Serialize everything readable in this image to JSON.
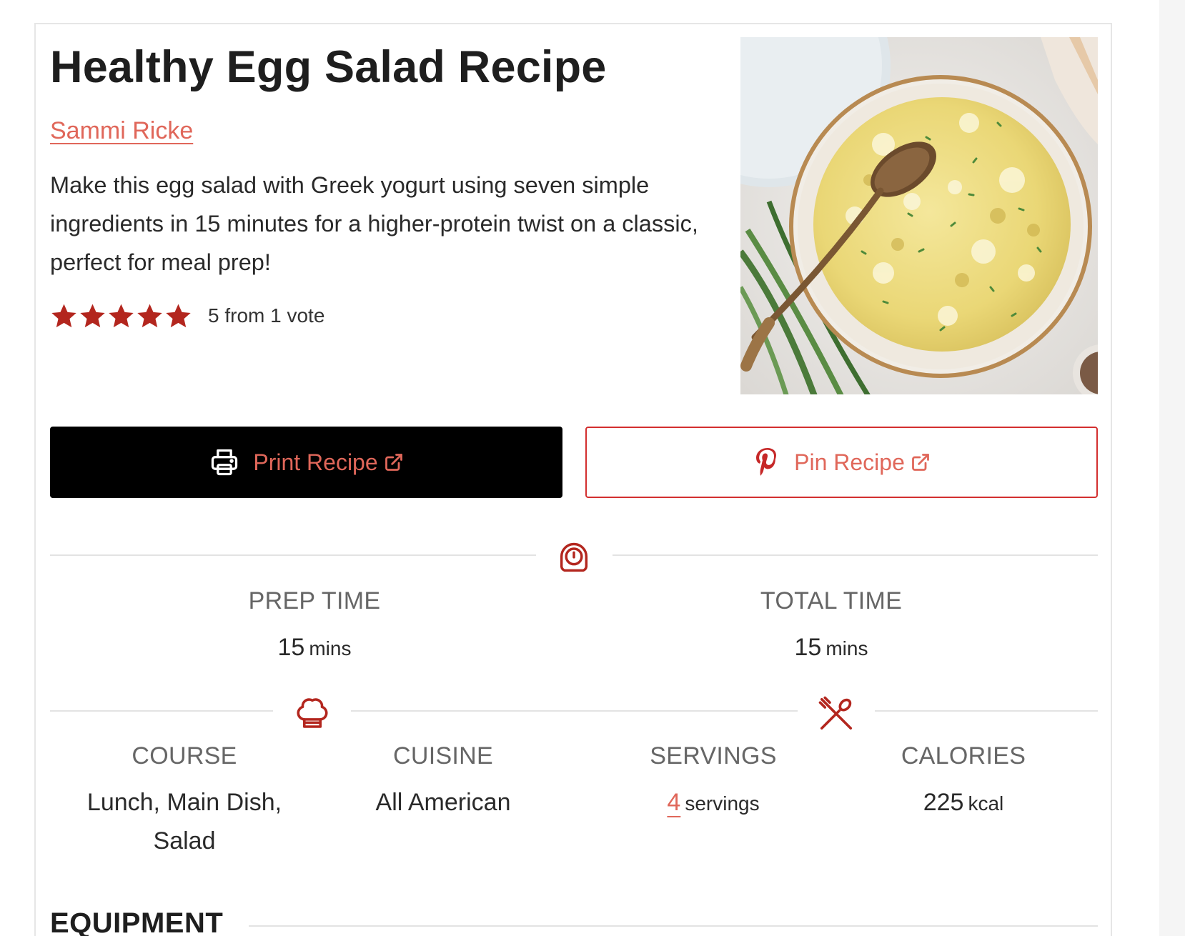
{
  "recipe": {
    "title": "Healthy Egg Salad Recipe",
    "author": "Sammi Ricke",
    "summary": "Make this egg salad with Greek yogurt using seven simple ingredients in 15 minutes for a higher-protein twist on a classic, perfect for meal prep!",
    "rating": {
      "stars": 5,
      "max_stars": 5,
      "text": "5 from 1 vote"
    }
  },
  "buttons": {
    "print_label": "Print Recipe",
    "pin_label": "Pin Recipe"
  },
  "times": {
    "prep": {
      "label": "PREP TIME",
      "value": "15",
      "unit": "mins"
    },
    "total": {
      "label": "TOTAL TIME",
      "value": "15",
      "unit": "mins"
    }
  },
  "details": {
    "course": {
      "label": "COURSE",
      "value": "Lunch, Main Dish, Salad"
    },
    "cuisine": {
      "label": "CUISINE",
      "value": "All American"
    },
    "servings": {
      "label": "SERVINGS",
      "value": "4",
      "unit": "servings"
    },
    "calories": {
      "label": "CALORIES",
      "value": "225",
      "unit": "kcal"
    }
  },
  "sections": {
    "equipment": "EQUIPMENT"
  },
  "colors": {
    "accent": "#e0675a",
    "icon_red": "#b3261e",
    "star": "#b3261e",
    "print_button_bg": "#000000",
    "pin_button_border": "#d32f2f"
  },
  "icons": {
    "print": "printer-icon",
    "pin": "pinterest-icon",
    "external": "external-link-icon",
    "time": "timer-icon",
    "course": "chef-hat-icon",
    "servings": "fork-knife-icon"
  }
}
